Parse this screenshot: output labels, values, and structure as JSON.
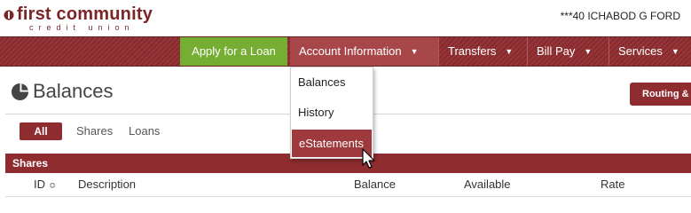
{
  "header": {
    "logo_main": "first community",
    "logo_sub": "credit union",
    "user_name": "***40 ICHABOD G FORD"
  },
  "nav": {
    "apply": "Apply for a Loan",
    "account_info": "Account Information",
    "transfers": "Transfers",
    "bill_pay": "Bill Pay",
    "services": "Services"
  },
  "dropdown": {
    "items": [
      "Balances",
      "History",
      "eStatements"
    ],
    "active_item": "eStatements"
  },
  "panel": {
    "title": "Balances",
    "routing_button": "Routing & A"
  },
  "filters": {
    "all": "All",
    "shares": "Shares",
    "loans": "Loans"
  },
  "section": {
    "title": "Shares"
  },
  "table": {
    "columns": [
      "ID",
      "Description",
      "Balance",
      "Available",
      "Rate"
    ]
  },
  "colors": {
    "brand": "#8f2c2f",
    "apply_green": "#76ae33",
    "nav_active": "#a8474a"
  },
  "icons": {
    "logo": "logo-icon",
    "section": "pie-chart-icon",
    "sort": "sort-icon",
    "caret": "chevron-down-icon",
    "cursor": "mouse-pointer-icon"
  }
}
